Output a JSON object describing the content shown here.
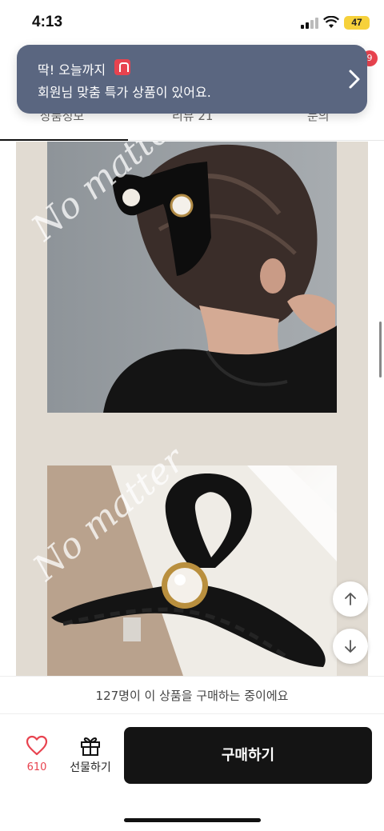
{
  "status_bar": {
    "time": "4:13",
    "battery": "47"
  },
  "tabs": [
    {
      "label": "상품정보"
    },
    {
      "label": "리뷰 21"
    },
    {
      "label": "문의"
    }
  ],
  "cart_badge": "9",
  "toast": {
    "line1": "딱! 오늘까지",
    "line2": "회원님 맞춤 특가 상품이 있어요."
  },
  "detail": {
    "watermark1": "No matter",
    "watermark2": "No matter"
  },
  "buyers_text": "127명이 이 상품을 구매하는 중이에요",
  "bottom_bar": {
    "like_count": "610",
    "gift_label": "선물하기",
    "buy_label": "구매하기"
  },
  "colors": {
    "accent_red": "#e8434f",
    "toast_bg": "#5a6680",
    "buy_button": "#141414",
    "detail_bg": "#e1dbd2"
  }
}
